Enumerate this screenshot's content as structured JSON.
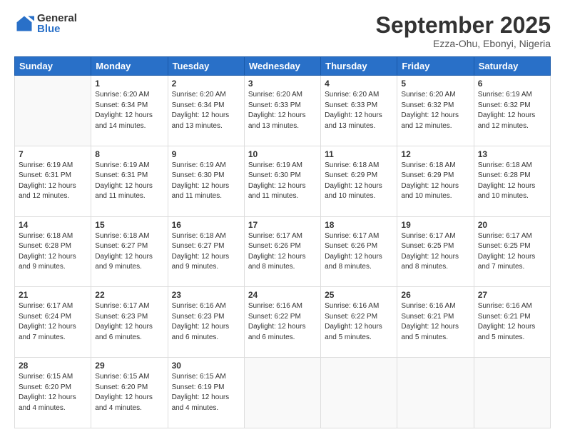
{
  "logo": {
    "general": "General",
    "blue": "Blue"
  },
  "title": "September 2025",
  "location": "Ezza-Ohu, Ebonyi, Nigeria",
  "days_header": [
    "Sunday",
    "Monday",
    "Tuesday",
    "Wednesday",
    "Thursday",
    "Friday",
    "Saturday"
  ],
  "weeks": [
    [
      {
        "num": "",
        "info": ""
      },
      {
        "num": "1",
        "info": "Sunrise: 6:20 AM\nSunset: 6:34 PM\nDaylight: 12 hours\nand 14 minutes."
      },
      {
        "num": "2",
        "info": "Sunrise: 6:20 AM\nSunset: 6:34 PM\nDaylight: 12 hours\nand 13 minutes."
      },
      {
        "num": "3",
        "info": "Sunrise: 6:20 AM\nSunset: 6:33 PM\nDaylight: 12 hours\nand 13 minutes."
      },
      {
        "num": "4",
        "info": "Sunrise: 6:20 AM\nSunset: 6:33 PM\nDaylight: 12 hours\nand 13 minutes."
      },
      {
        "num": "5",
        "info": "Sunrise: 6:20 AM\nSunset: 6:32 PM\nDaylight: 12 hours\nand 12 minutes."
      },
      {
        "num": "6",
        "info": "Sunrise: 6:19 AM\nSunset: 6:32 PM\nDaylight: 12 hours\nand 12 minutes."
      }
    ],
    [
      {
        "num": "7",
        "info": "Sunrise: 6:19 AM\nSunset: 6:31 PM\nDaylight: 12 hours\nand 12 minutes."
      },
      {
        "num": "8",
        "info": "Sunrise: 6:19 AM\nSunset: 6:31 PM\nDaylight: 12 hours\nand 11 minutes."
      },
      {
        "num": "9",
        "info": "Sunrise: 6:19 AM\nSunset: 6:30 PM\nDaylight: 12 hours\nand 11 minutes."
      },
      {
        "num": "10",
        "info": "Sunrise: 6:19 AM\nSunset: 6:30 PM\nDaylight: 12 hours\nand 11 minutes."
      },
      {
        "num": "11",
        "info": "Sunrise: 6:18 AM\nSunset: 6:29 PM\nDaylight: 12 hours\nand 10 minutes."
      },
      {
        "num": "12",
        "info": "Sunrise: 6:18 AM\nSunset: 6:29 PM\nDaylight: 12 hours\nand 10 minutes."
      },
      {
        "num": "13",
        "info": "Sunrise: 6:18 AM\nSunset: 6:28 PM\nDaylight: 12 hours\nand 10 minutes."
      }
    ],
    [
      {
        "num": "14",
        "info": "Sunrise: 6:18 AM\nSunset: 6:28 PM\nDaylight: 12 hours\nand 9 minutes."
      },
      {
        "num": "15",
        "info": "Sunrise: 6:18 AM\nSunset: 6:27 PM\nDaylight: 12 hours\nand 9 minutes."
      },
      {
        "num": "16",
        "info": "Sunrise: 6:18 AM\nSunset: 6:27 PM\nDaylight: 12 hours\nand 9 minutes."
      },
      {
        "num": "17",
        "info": "Sunrise: 6:17 AM\nSunset: 6:26 PM\nDaylight: 12 hours\nand 8 minutes."
      },
      {
        "num": "18",
        "info": "Sunrise: 6:17 AM\nSunset: 6:26 PM\nDaylight: 12 hours\nand 8 minutes."
      },
      {
        "num": "19",
        "info": "Sunrise: 6:17 AM\nSunset: 6:25 PM\nDaylight: 12 hours\nand 8 minutes."
      },
      {
        "num": "20",
        "info": "Sunrise: 6:17 AM\nSunset: 6:25 PM\nDaylight: 12 hours\nand 7 minutes."
      }
    ],
    [
      {
        "num": "21",
        "info": "Sunrise: 6:17 AM\nSunset: 6:24 PM\nDaylight: 12 hours\nand 7 minutes."
      },
      {
        "num": "22",
        "info": "Sunrise: 6:17 AM\nSunset: 6:23 PM\nDaylight: 12 hours\nand 6 minutes."
      },
      {
        "num": "23",
        "info": "Sunrise: 6:16 AM\nSunset: 6:23 PM\nDaylight: 12 hours\nand 6 minutes."
      },
      {
        "num": "24",
        "info": "Sunrise: 6:16 AM\nSunset: 6:22 PM\nDaylight: 12 hours\nand 6 minutes."
      },
      {
        "num": "25",
        "info": "Sunrise: 6:16 AM\nSunset: 6:22 PM\nDaylight: 12 hours\nand 5 minutes."
      },
      {
        "num": "26",
        "info": "Sunrise: 6:16 AM\nSunset: 6:21 PM\nDaylight: 12 hours\nand 5 minutes."
      },
      {
        "num": "27",
        "info": "Sunrise: 6:16 AM\nSunset: 6:21 PM\nDaylight: 12 hours\nand 5 minutes."
      }
    ],
    [
      {
        "num": "28",
        "info": "Sunrise: 6:15 AM\nSunset: 6:20 PM\nDaylight: 12 hours\nand 4 minutes."
      },
      {
        "num": "29",
        "info": "Sunrise: 6:15 AM\nSunset: 6:20 PM\nDaylight: 12 hours\nand 4 minutes."
      },
      {
        "num": "30",
        "info": "Sunrise: 6:15 AM\nSunset: 6:19 PM\nDaylight: 12 hours\nand 4 minutes."
      },
      {
        "num": "",
        "info": ""
      },
      {
        "num": "",
        "info": ""
      },
      {
        "num": "",
        "info": ""
      },
      {
        "num": "",
        "info": ""
      }
    ]
  ]
}
